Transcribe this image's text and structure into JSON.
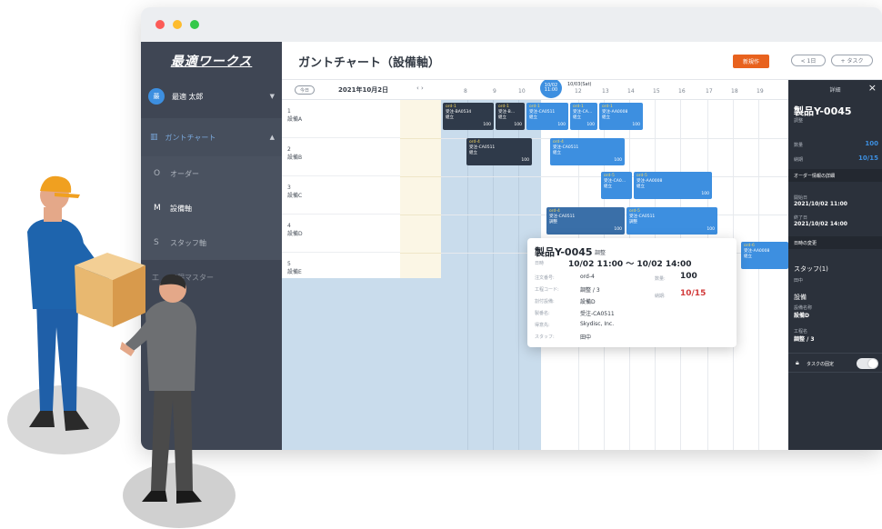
{
  "app": {
    "brand": "最適ワークス"
  },
  "user": {
    "name": "最適 太郎",
    "avatar_initial": "最"
  },
  "sidebar": {
    "gantt_label": "ガントチャート",
    "items": [
      {
        "icon": "O",
        "label": "オーダー"
      },
      {
        "icon": "M",
        "label": "設備軸"
      },
      {
        "icon": "S",
        "label": "スタッフ軸"
      },
      {
        "icon": "工",
        "label": "工程マスター"
      }
    ]
  },
  "header": {
    "title": "ガントチャート（設備軸）",
    "new_button": "新規作",
    "pill_1day": "< 1日",
    "pill_task": "+ タスク"
  },
  "gantt": {
    "today_button": "今日",
    "date": "2021年10月2日",
    "nav": "‹ ›",
    "hours": [
      "8",
      "9",
      "10",
      "12",
      "13",
      "14",
      "15",
      "16",
      "17",
      "18",
      "19"
    ],
    "now_badge": {
      "date": "10/02",
      "time": "11:00"
    },
    "sat_label": "10/03(Sat)",
    "rows": [
      {
        "num": "1",
        "name": "設備A"
      },
      {
        "num": "2",
        "name": "設備B"
      },
      {
        "num": "3",
        "name": "設備C"
      },
      {
        "num": "4",
        "name": "設備D"
      },
      {
        "num": "5",
        "name": "設備E"
      }
    ],
    "bars": [
      {
        "ord": "ord-1",
        "item": "受注-BA0534",
        "proc": "組立",
        "qty": "100"
      },
      {
        "ord": "ord-1",
        "item": "受注-B…",
        "proc": "組立",
        "qty": "100"
      },
      {
        "ord": "ord-1",
        "item": "受注-CA0511",
        "proc": "組立",
        "qty": "100"
      },
      {
        "ord": "ord-1",
        "item": "受注-CA…",
        "proc": "組立",
        "qty": "100"
      },
      {
        "ord": "ord-1",
        "item": "受注-AA0008",
        "proc": "組立",
        "qty": "100"
      },
      {
        "ord": "ord-4",
        "item": "受注-CA0511",
        "proc": "組立",
        "qty": "100"
      },
      {
        "ord": "ord-4",
        "item": "受注-CA0511",
        "proc": "組立",
        "qty": "100"
      },
      {
        "ord": "ord-5",
        "item": "受注-CA0…",
        "proc": "組立",
        "qty": ""
      },
      {
        "ord": "ord-5",
        "item": "受注-AA0008",
        "proc": "組立",
        "qty": "100"
      },
      {
        "ord": "ord-4",
        "item": "受注-CA0511",
        "proc": "調整",
        "qty": "100"
      },
      {
        "ord": "ord-5",
        "item": "受注-CA0511",
        "proc": "調整",
        "qty": "100"
      },
      {
        "ord": "ord-6",
        "item": "受注-AA0008",
        "proc": "組立",
        "qty": ""
      }
    ]
  },
  "popup": {
    "title": "製品Y-0045",
    "tag": "調整",
    "time_label": "日時",
    "time": "10/02 11:00 〜 10/02 14:00",
    "fields": [
      {
        "k": "注文番号:",
        "v": "ord-4"
      },
      {
        "k": "工程コード:",
        "v": "調整 / 3"
      },
      {
        "k": "割付設備:",
        "v": "設備D"
      },
      {
        "k": "製番名:",
        "v": "受注-CA0511"
      },
      {
        "k": "得意先:",
        "v": "Skydisc, Inc."
      },
      {
        "k": "スタッフ:",
        "v": "田中"
      }
    ],
    "qty_label": "数量:",
    "qty": "100",
    "due_label": "納期:",
    "due": "10/15"
  },
  "detail": {
    "header": "詳細",
    "close": "×",
    "title": "製品Y-0045",
    "subtitle": "調整",
    "qty_label": "数量",
    "qty": "100",
    "due_label": "納期",
    "due": "10/15",
    "order_section": "オーダー情報の詳細",
    "start_label": "開始日",
    "start": "2021/10/02 11:00",
    "end_label": "終了日",
    "end": "2021/10/02 14:00",
    "change_section": "日時の変更",
    "staff_label": "スタッフ(1)",
    "staff": "田中",
    "equip_section": "設備",
    "equip_label": "設備名称",
    "equip": "設備D",
    "proc_label": "工程名",
    "proc": "調整 / 3",
    "lock_label": "タスクの固定"
  },
  "colors": {
    "sidebar": "#3f4654",
    "accent_blue": "#3d8fe0",
    "new_button": "#e8621e",
    "bar_dark": "#2f3a4a",
    "detail_panel": "#2b313b",
    "illus_shirt_blue": "#1e64ad",
    "illus_cap": "#f0a020",
    "illus_box": "#e8b870"
  }
}
